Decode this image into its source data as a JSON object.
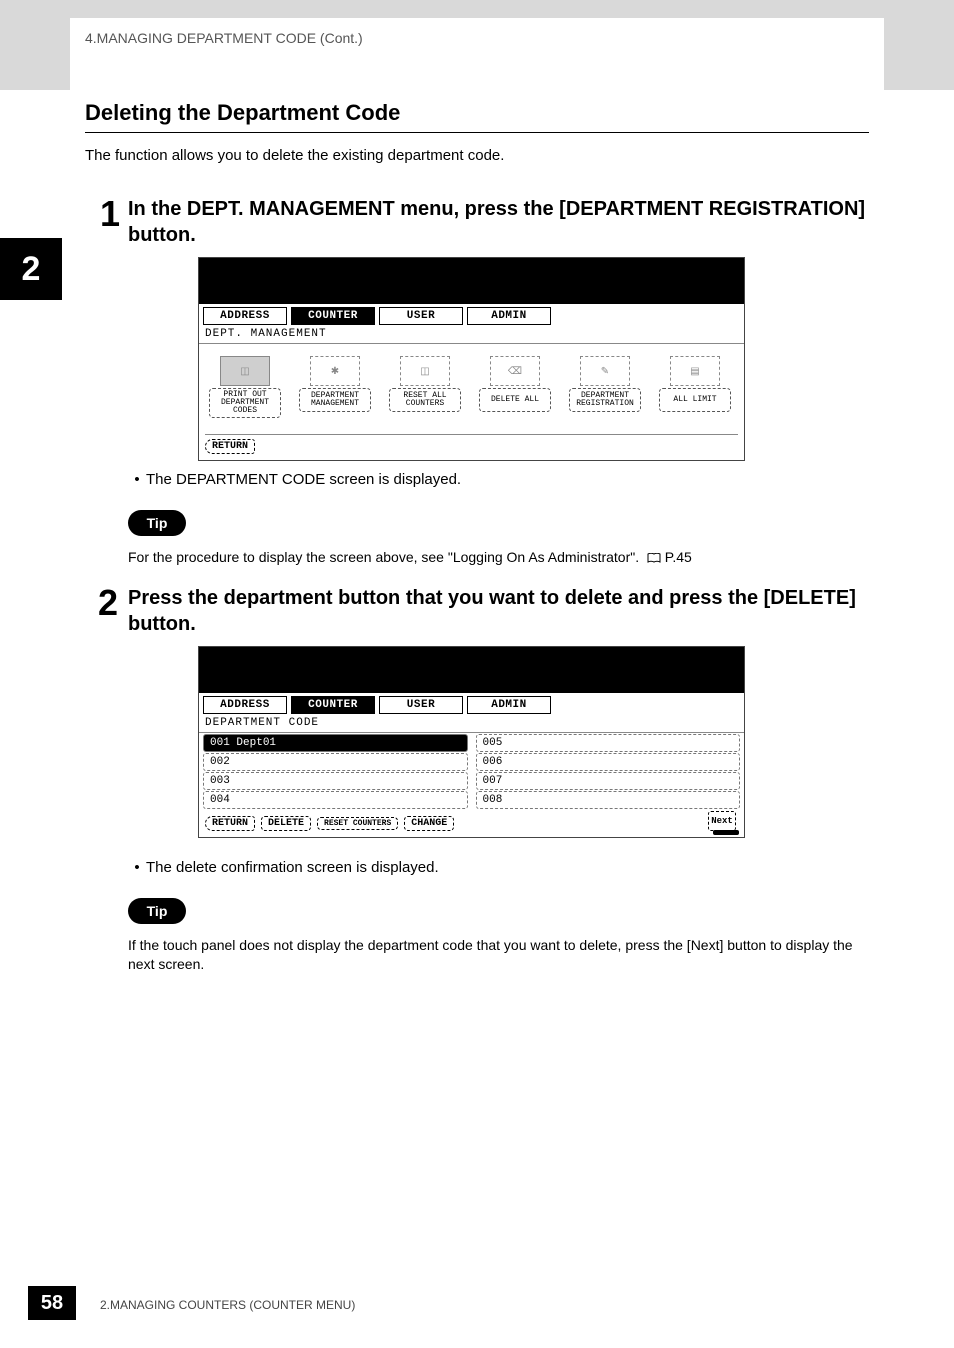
{
  "header": {
    "breadcrumb": "4.MANAGING DEPARTMENT CODE (Cont.)"
  },
  "section": {
    "title": "Deleting the Department Code",
    "intro": "The function allows you to delete the existing department code."
  },
  "chapter_tab": "2",
  "step1": {
    "num": "1",
    "text": "In the DEPT. MANAGEMENT menu, press the [DEPARTMENT REGISTRATION] button.",
    "bullet": "The DEPARTMENT CODE screen is displayed."
  },
  "ss1": {
    "tabs": {
      "address": "ADDRESS",
      "counter": "COUNTER",
      "user": "USER",
      "admin": "ADMIN"
    },
    "subheader": "DEPT. MANAGEMENT",
    "buttons": {
      "print": "PRINT OUT DEPARTMENT CODES",
      "mgmt": "DEPARTMENT MANAGEMENT",
      "reset": "RESET ALL COUNTERS",
      "delall": "DELETE ALL",
      "reg": "DEPARTMENT REGISTRATION",
      "limit": "ALL LIMIT"
    },
    "return": "RETURN"
  },
  "tip1": {
    "label": "Tip",
    "text_pre": "For the procedure to display the screen above, see \"Logging On As Administrator\".",
    "page_ref": "P.45"
  },
  "step2": {
    "num": "2",
    "text": "Press the department button that you want to delete and press the [DELETE] button.",
    "bullet": "The delete confirmation screen is displayed."
  },
  "ss2": {
    "tabs": {
      "address": "ADDRESS",
      "counter": "COUNTER",
      "user": "USER",
      "admin": "ADMIN"
    },
    "subheader": "DEPARTMENT CODE",
    "rows_left": [
      {
        "id": "001",
        "name": "Dept01",
        "selected": true
      },
      {
        "id": "002",
        "name": "",
        "selected": false
      },
      {
        "id": "003",
        "name": "",
        "selected": false
      },
      {
        "id": "004",
        "name": "",
        "selected": false
      }
    ],
    "rows_right": [
      {
        "id": "005"
      },
      {
        "id": "006"
      },
      {
        "id": "007"
      },
      {
        "id": "008"
      }
    ],
    "footer": {
      "return": "RETURN",
      "delete": "DELETE",
      "reset": "RESET COUNTERS",
      "change": "CHANGE",
      "next": "Next"
    }
  },
  "tip2": {
    "label": "Tip",
    "text": "If the touch panel does not display the department code that you want to delete, press the [Next] button to display the next screen."
  },
  "footer": {
    "page": "58",
    "text": "2.MANAGING COUNTERS (COUNTER MENU)"
  }
}
